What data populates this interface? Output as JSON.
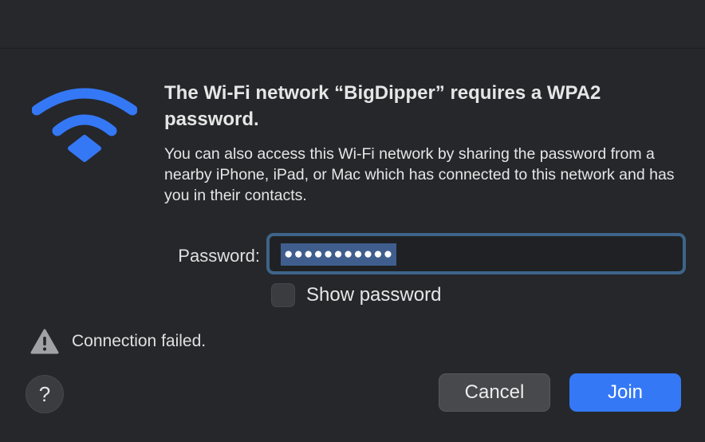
{
  "dialog": {
    "title": "The Wi-Fi network “BigDipper” requires a WPA2 password.",
    "description": "You can also access this Wi-Fi network by sharing the password from a nearby iPhone, iPad, or Mac which has connected to this network and has you in their contacts.",
    "icon": "wifi-icon"
  },
  "password": {
    "label": "Password:",
    "masked_value": "●●●●●●●●●●●"
  },
  "show_password": {
    "label": "Show password",
    "checked": false
  },
  "status": {
    "icon": "warning-icon",
    "text": "Connection failed."
  },
  "buttons": {
    "help_label": "?",
    "cancel_label": "Cancel",
    "join_label": "Join"
  },
  "colors": {
    "accent": "#3478f6",
    "wifi_icon": "#3478f6",
    "background": "#25272b"
  }
}
